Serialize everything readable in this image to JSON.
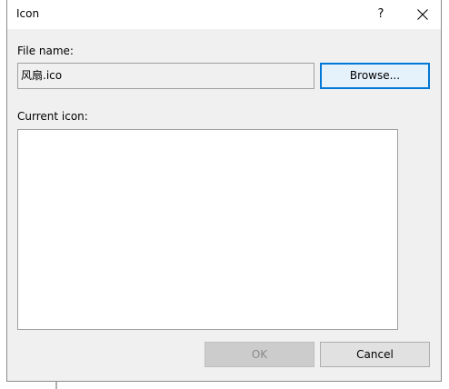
{
  "window": {
    "title": "Icon",
    "help_label": "?",
    "close_icon": "close-icon"
  },
  "file": {
    "label": "File name:",
    "value": "风扇.ico"
  },
  "buttons": {
    "browse": "Browse...",
    "ok": "OK",
    "cancel": "Cancel"
  },
  "preview": {
    "label": "Current icon:"
  },
  "colors": {
    "focus_border": "#0078d7",
    "dialog_bg": "#f0f0f0",
    "disabled_text": "#8a8a8a"
  }
}
